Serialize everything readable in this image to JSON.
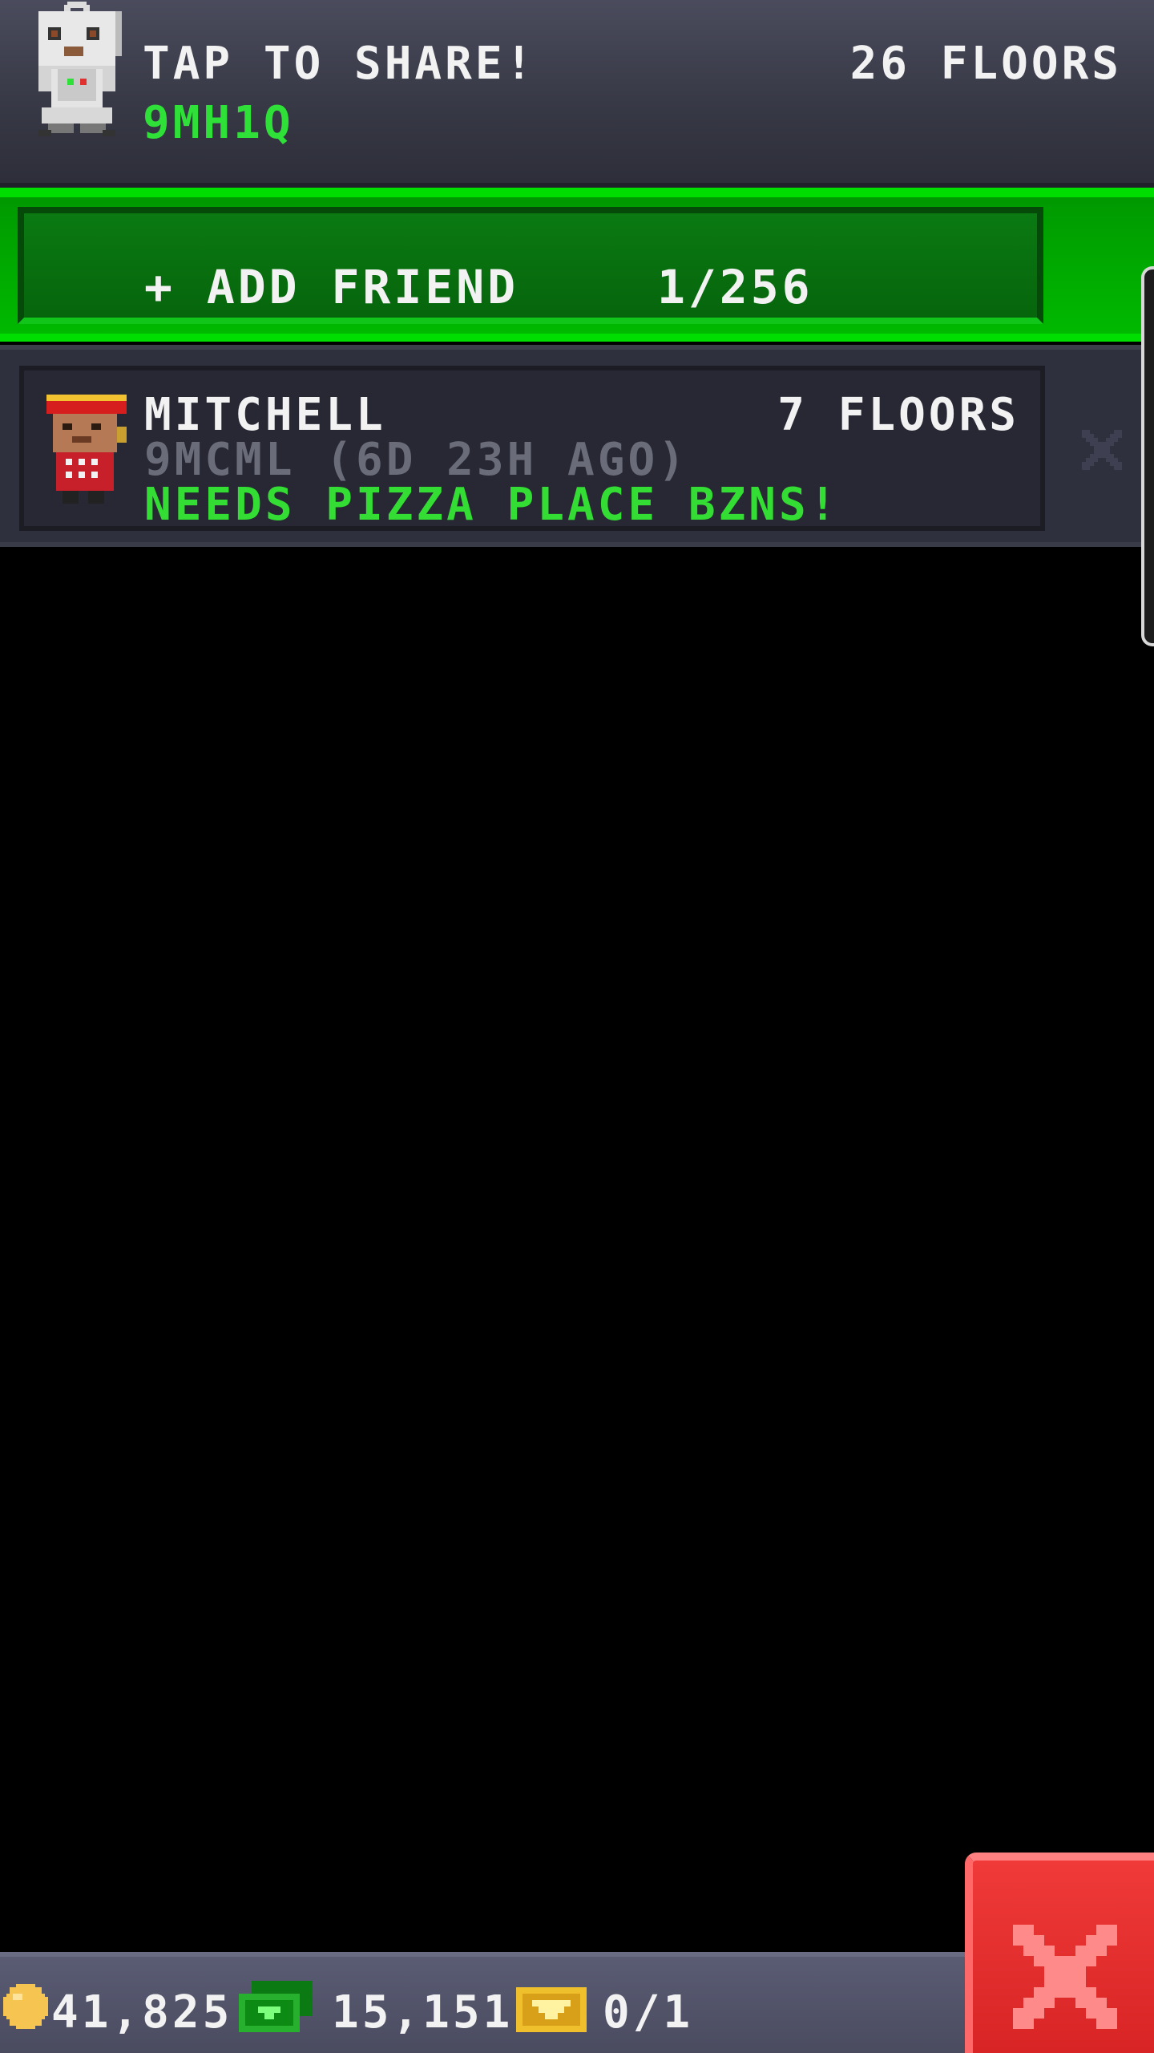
{
  "header": {
    "share_title": "TAP TO SHARE!",
    "share_code": "9MH1Q",
    "floors": "26 FLOORS",
    "code_color": "#2fe038"
  },
  "add_friend": {
    "label": "+ ADD FRIEND",
    "count": "1/256",
    "accent": "#00dd00"
  },
  "friends": [
    {
      "name": "MITCHELL",
      "floors": "7 FLOORS",
      "code_info": "9MCML (6D 23H AGO)",
      "status": "NEEDS PIZZA PLACE BZNS!",
      "status_color": "#33dd33",
      "remove_icon": "close-icon"
    }
  ],
  "currency": {
    "coins": "41,825",
    "bux": "15,151",
    "tickets": "0/1",
    "coin_icon": "coin-icon",
    "bux_icon": "bux-icon",
    "ticket_icon": "golden-ticket-icon"
  },
  "close_button": {
    "icon": "close-icon",
    "color": "#e53232"
  }
}
